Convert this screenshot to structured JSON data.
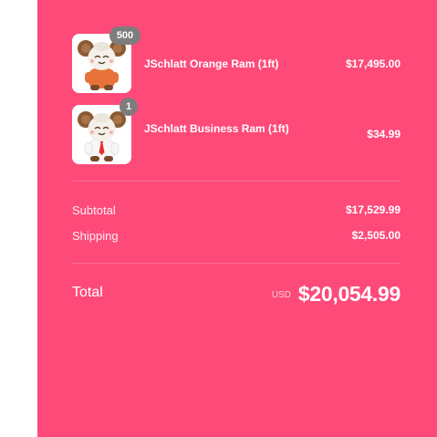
{
  "cart": {
    "items": [
      {
        "quantity": "500",
        "name": "JSchlatt Orange Ram (1ft)",
        "price": "$17,495.00",
        "image_icon": "orange-ram-plush-icon",
        "outfit_color": "#e8733a"
      },
      {
        "quantity": "1",
        "name": "JSchlatt Business Ram (1ft)",
        "price": "$34.99",
        "image_icon": "business-ram-plush-icon",
        "outfit_color": "#ffffff"
      }
    ]
  },
  "summary": {
    "subtotal_label": "Subtotal",
    "subtotal_value": "$17,529.99",
    "shipping_label": "Shipping",
    "shipping_value": "$2,505.00",
    "total_label": "Total",
    "currency": "USD",
    "total_value": "$20,054.99"
  },
  "colors": {
    "panel_background": "#fe4a79",
    "badge_background": "#7d7d7d",
    "page_background": "#ffffff"
  }
}
